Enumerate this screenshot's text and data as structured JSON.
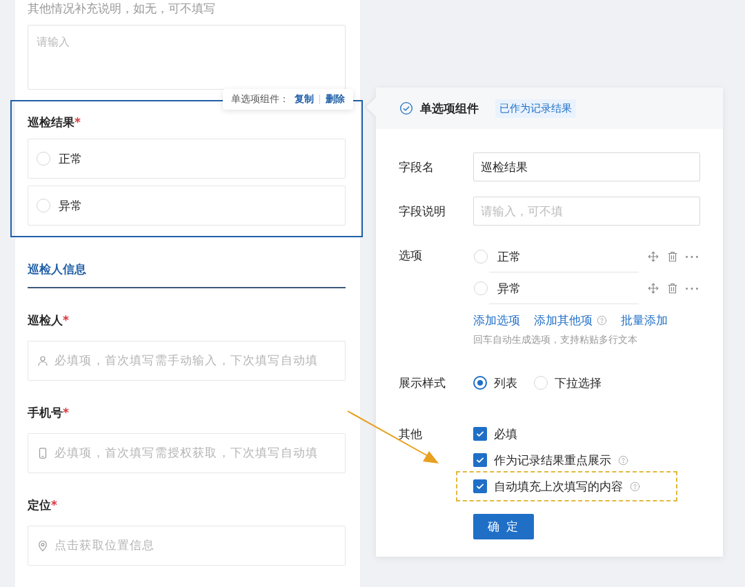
{
  "form": {
    "hint": "其他情况补充说明，如无，可不填写",
    "textarea": {
      "placeholder": "请输入"
    },
    "selected_field": {
      "label": "巡检结果",
      "required_mark": "*",
      "toolbar": {
        "title": "单选项组件：",
        "actions": [
          "复制",
          "删除"
        ]
      },
      "options": [
        {
          "label": "正常",
          "selected": false
        },
        {
          "label": "异常",
          "selected": false
        }
      ]
    },
    "section_title": "巡检人信息",
    "fields": [
      {
        "label": "巡检人",
        "required_mark": "*",
        "kind": "person",
        "placeholder": "必填项，首次填写需手动输入，下次填写自动填"
      },
      {
        "label": "手机号",
        "required_mark": "*",
        "kind": "phone",
        "placeholder": "必填项，首次填写需授权获取，下次填写自动填"
      },
      {
        "label": "定位",
        "required_mark": "*",
        "kind": "location",
        "placeholder": "点击获取位置信息"
      }
    ]
  },
  "panel": {
    "title": "单选项组件",
    "badge": "已作为记录结果",
    "field_name": {
      "label": "字段名",
      "value": "巡检结果"
    },
    "field_desc": {
      "label": "字段说明",
      "placeholder": "请输入，可不填"
    },
    "options": {
      "label": "选项",
      "items": [
        {
          "label": "正常",
          "selected": false
        },
        {
          "label": "异常",
          "selected": false
        }
      ],
      "links": [
        {
          "text": "添加选项",
          "help": false
        },
        {
          "text": "添加其他项",
          "help": true
        },
        {
          "text": "批量添加",
          "help": false
        }
      ],
      "hint": "回车自动生成选项，支持粘贴多行文本"
    },
    "display_style": {
      "label": "展示样式",
      "choices": [
        {
          "label": "列表",
          "selected": true
        },
        {
          "label": "下拉选择",
          "selected": false
        }
      ]
    },
    "other": {
      "label": "其他",
      "checkboxes": [
        {
          "label": "必填",
          "checked": true,
          "help": false,
          "highlighted": false
        },
        {
          "label": "作为记录结果重点展示",
          "checked": true,
          "help": true,
          "highlighted": false
        },
        {
          "label": "自动填充上次填写的内容",
          "checked": true,
          "help": true,
          "highlighted": true
        }
      ]
    },
    "confirm": "确 定"
  }
}
